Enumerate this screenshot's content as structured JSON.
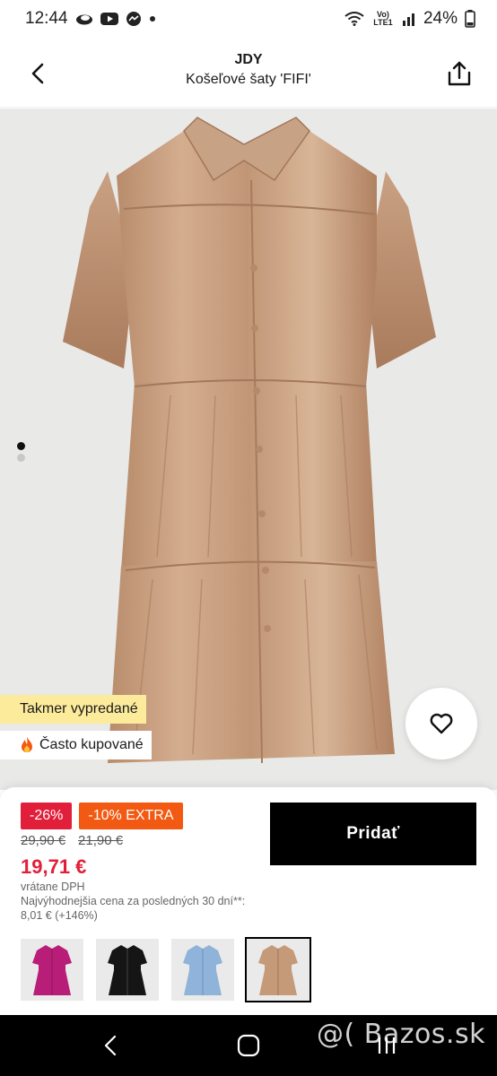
{
  "status_bar": {
    "time": "12:44",
    "battery": "24%",
    "network_label": "Vo) LTE1"
  },
  "header": {
    "brand": "JDY",
    "title": "Košeľové šaty 'FIFI'"
  },
  "gallery": {
    "image_count": 2,
    "active_index": 0,
    "dress_color": "#c49a79",
    "background": "#e9e9e8"
  },
  "badges": {
    "sold_out_soon": "Takmer vypredané",
    "often_bought": "Často kupované",
    "often_bought_icon": "fire-icon"
  },
  "price": {
    "discount": "-26%",
    "extra_discount": "-10% EXTRA",
    "original_price": "29,90 €",
    "previous_price": "21,90 €",
    "final_price": "19,71 €",
    "vat_note": "vrátane DPH",
    "lowest_price_note": "Najvýhodnejšia cena za posledných 30 dní**: 8,01 € (+146%)"
  },
  "actions": {
    "add_to_cart": "Pridať"
  },
  "variants": [
    {
      "color_name": "magenta",
      "color": "#b81e78",
      "selected": false
    },
    {
      "color_name": "black",
      "color": "#151515",
      "selected": false
    },
    {
      "color_name": "light blue",
      "color": "#8fb3d9",
      "selected": false
    },
    {
      "color_name": "tan",
      "color": "#c49a79",
      "selected": true
    }
  ],
  "watermark": "@( Bazos.sk",
  "colors": {
    "accent_red": "#e21f3a",
    "accent_orange": "#f25a13",
    "badge_yellow": "#fdeb9c",
    "primary_button": "#000000"
  }
}
